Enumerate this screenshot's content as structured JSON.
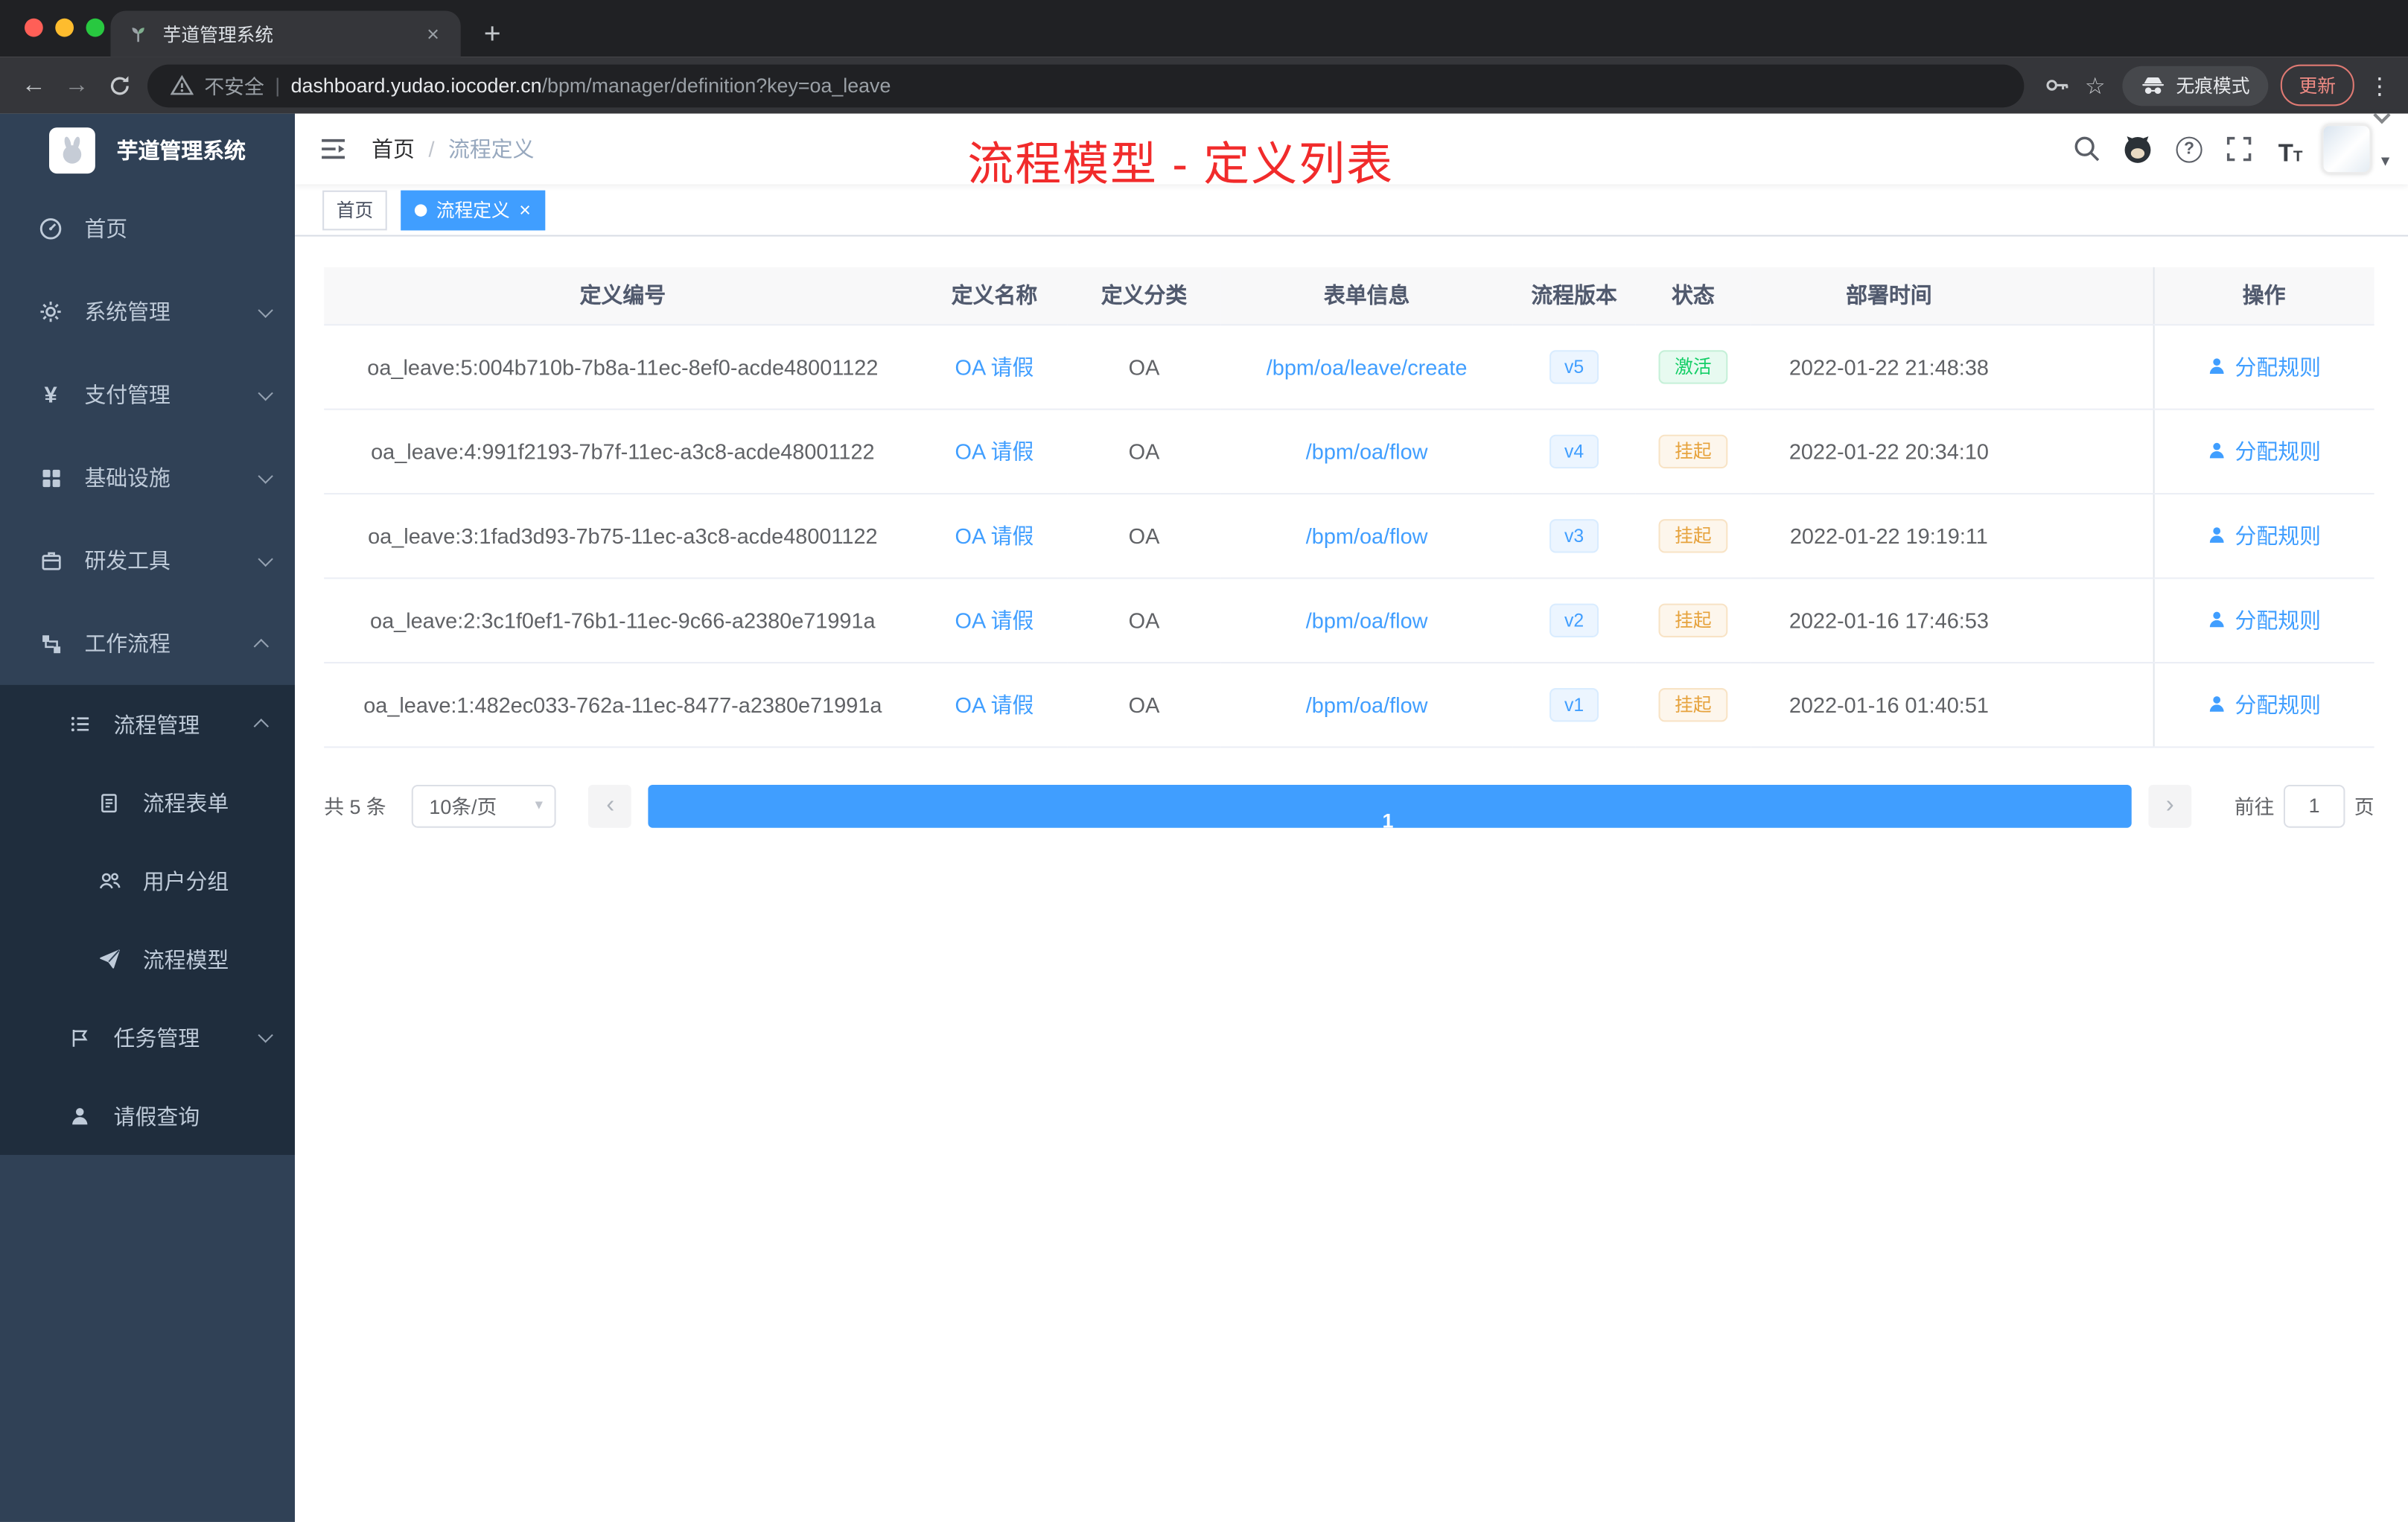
{
  "browser": {
    "tab_title": "芋道管理系统",
    "security_label": "不安全",
    "url_host": "dashboard.yudao.iocoder.cn",
    "url_path": "/bpm/manager/definition?key=oa_leave",
    "incognito_label": "无痕模式",
    "update_label": "更新"
  },
  "icons": {
    "close": "×",
    "new_tab": "+",
    "back": "←",
    "forward": "→",
    "star": "☆",
    "kebab": "⋮",
    "url_separator": "|",
    "yen": "¥",
    "help": "?",
    "font_size_big": "T",
    "font_size_small": "T",
    "caret_down": "▾",
    "breadcrumb_separator": "/",
    "pager_prev": "‹",
    "pager_next": "›"
  },
  "sidebar": {
    "title": "芋道管理系统",
    "items": [
      {
        "label": "首页"
      },
      {
        "label": "系统管理"
      },
      {
        "label": "支付管理"
      },
      {
        "label": "基础设施"
      },
      {
        "label": "研发工具"
      },
      {
        "label": "工作流程"
      },
      {
        "label": "流程管理"
      },
      {
        "label": "流程表单"
      },
      {
        "label": "用户分组"
      },
      {
        "label": "流程模型"
      },
      {
        "label": "任务管理"
      },
      {
        "label": "请假查询"
      }
    ]
  },
  "topbar": {
    "breadcrumb_home": "首页",
    "breadcrumb_current": "流程定义",
    "annotation": "流程模型 - 定义列表"
  },
  "tags": {
    "home": "首页",
    "active": "流程定义"
  },
  "table": {
    "columns": [
      "定义编号",
      "定义名称",
      "定义分类",
      "表单信息",
      "流程版本",
      "状态",
      "部署时间",
      "操作"
    ],
    "action_label": "分配规则",
    "rows": [
      {
        "id": "oa_leave:5:004b710b-7b8a-11ec-8ef0-acde48001122",
        "name": "OA 请假",
        "category": "OA",
        "form": "/bpm/oa/leave/create",
        "version": "v5",
        "status": "激活",
        "time": "2022-01-22 21:48:38"
      },
      {
        "id": "oa_leave:4:991f2193-7b7f-11ec-a3c8-acde48001122",
        "name": "OA 请假",
        "category": "OA",
        "form": "/bpm/oa/flow",
        "version": "v4",
        "status": "挂起",
        "time": "2022-01-22 20:34:10"
      },
      {
        "id": "oa_leave:3:1fad3d93-7b75-11ec-a3c8-acde48001122",
        "name": "OA 请假",
        "category": "OA",
        "form": "/bpm/oa/flow",
        "version": "v3",
        "status": "挂起",
        "time": "2022-01-22 19:19:11"
      },
      {
        "id": "oa_leave:2:3c1f0ef1-76b1-11ec-9c66-a2380e71991a",
        "name": "OA 请假",
        "category": "OA",
        "form": "/bpm/oa/flow",
        "version": "v2",
        "status": "挂起",
        "time": "2022-01-16 17:46:53"
      },
      {
        "id": "oa_leave:1:482ec033-762a-11ec-8477-a2380e71991a",
        "name": "OA 请假",
        "category": "OA",
        "form": "/bpm/oa/flow",
        "version": "v1",
        "status": "挂起",
        "time": "2022-01-16 01:40:51"
      }
    ]
  },
  "pagination": {
    "total": "共 5 条",
    "page_size": "10条/页",
    "page": "1",
    "goto_label": "前往",
    "goto_value": "1",
    "page_unit": "页"
  },
  "colors": {
    "accent": "#409eff",
    "annotation": "#f12b2b",
    "success": "#13ce66",
    "warning": "#e6a23c",
    "sidebar_bg": "#304156",
    "submenu_bg": "#1f2d3d"
  }
}
